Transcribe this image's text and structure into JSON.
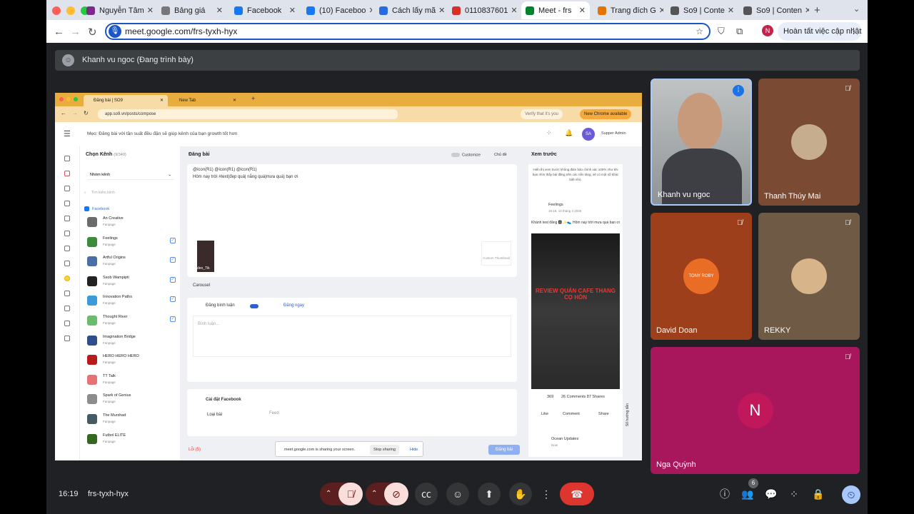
{
  "browser": {
    "tabs": [
      {
        "label": "Nguyễn Tâm",
        "color": "#7b2c8a"
      },
      {
        "label": "Bảng giá",
        "color": "#777777"
      },
      {
        "label": "Facebook",
        "color": "#1877f2"
      },
      {
        "label": "(10) Faceboo",
        "color": "#1877f2"
      },
      {
        "label": "Cách lấy mã",
        "color": "#2a6ae0"
      },
      {
        "label": "0110837601",
        "color": "#d93025"
      },
      {
        "label": "Meet - frs",
        "color": "#00832d"
      },
      {
        "label": "Trang đích G",
        "color": "#e37400"
      },
      {
        "label": "So9 | Conte",
        "color": "#555555"
      },
      {
        "label": "So9 | Conten",
        "color": "#555555"
      }
    ],
    "url": "meet.google.com/frs-tyxh-hyx",
    "avatar_letter": "N",
    "update_button": "Hoàn tất việc cập nhật"
  },
  "meet": {
    "presenting_banner": "Khanh vu ngoc (Đang trình bày)",
    "meeting_time": "16:19",
    "meeting_code": "frs-tyxh-hyx",
    "participant_count": "6",
    "participants": [
      {
        "name": "Khanh vu ngoc",
        "state": "speaking"
      },
      {
        "name": "Thanh Thúy Mai",
        "state": "muted"
      },
      {
        "name": "David Doan",
        "state": "muted",
        "logo_text": "TONY ROBY"
      },
      {
        "name": "REKKY",
        "state": "muted"
      },
      {
        "name": "Nga Quỳnh",
        "state": "muted",
        "avatar_letter": "N"
      }
    ]
  },
  "shared_screen": {
    "tabs": [
      "Đăng bài | SO9",
      "New Tab"
    ],
    "url": "app.so9.vn/posts/compose",
    "verify_label": "Verify that it's you",
    "new_chrome_label": "New Chrome available",
    "tip": "Mẹo: Đăng bài với tần suất đều đặn sẽ giúp kênh của bạn growth tốt hơn",
    "user_initials": "SA",
    "user_role": "Supper Admin",
    "channel_header": "Chọn Kênh",
    "channel_count": "(9/340)",
    "channel_group": "Nhóm kênh",
    "channel_search": "Tìm kiếm kênh",
    "facebook_label": "Facebook",
    "channels": [
      {
        "name": "An Creative",
        "type": "Fanpage",
        "checked": false,
        "color": "#6b6b6b"
      },
      {
        "name": "Feelings",
        "type": "Fanpage",
        "checked": true,
        "color": "#3c8c3c"
      },
      {
        "name": "Artful Origins",
        "type": "Fanpage",
        "checked": true,
        "color": "#4a6fa5"
      },
      {
        "name": "Ssob Wampipti",
        "type": "Fanpage",
        "checked": true,
        "color": "#222222"
      },
      {
        "name": "Innovation Paths",
        "type": "Fanpage",
        "checked": true,
        "color": "#3a9bd8"
      },
      {
        "name": "Thought River",
        "type": "Fanpage",
        "checked": true,
        "color": "#6dbb6d"
      },
      {
        "name": "Imagination Bridge",
        "type": "Fanpage",
        "checked": false,
        "color": "#2e4e8c"
      },
      {
        "name": "HERO HERO HERO",
        "type": "Fanpage",
        "checked": false,
        "color": "#b71c1c"
      },
      {
        "name": "TT Talk",
        "type": "Fanpage",
        "checked": false,
        "color": "#e57373"
      },
      {
        "name": "Spark of Genius",
        "type": "Fanpage",
        "checked": false,
        "color": "#8d8d8d"
      },
      {
        "name": "The Murshad",
        "type": "Fanpage",
        "checked": false,
        "color": "#455a64"
      },
      {
        "name": "Futbol ELITE",
        "type": "Fanpage",
        "checked": false,
        "color": "#33691e"
      }
    ],
    "compose_title": "Đăng bài",
    "customize_label": "Customize",
    "theme_label": "Chủ đề",
    "compose_line1": "@icon(R1) @icon(R1) @icon(R1)",
    "compose_line2": "Hôm nay trời #text(đẹp quá| nắng quá|mưa quá) bạn ơi",
    "video_label": "deo_Tik",
    "custom_thumbnail": "Custom Thumbnail",
    "carousel_label": "Carousel",
    "comment_toggle": "Đăng bình luận",
    "post_now": "Đăng ngay",
    "comment_placeholder": "Bình luận...",
    "fb_settings": "Cài đặt Facebook",
    "post_type_label": "Loại bài",
    "post_type_value": "Feed",
    "error_label": "Lỗi (5)",
    "submit_label": "Đăng bài",
    "preview_title": "Xem trước",
    "preview_note": "Hiển thị xem trước không đảm bảo chính xác 100% như khi bạn nhìn thấy bài đăng trên các nền tảng, sẽ có một số khác biệt nhỏ.",
    "preview_page": "Feelings",
    "preview_date": "16:19, 14 tháng 4 2025",
    "preview_text": "Khánh test đăng 🅰 ✨👟 Hôm nay trời mưa quá bạn ơi",
    "video_overlay": "REVIEW QUÁN CAFE THANG CỌ HỒN",
    "reactions_count": "369",
    "comments_shares": "26 Comments 87 Shares",
    "like_label": "Like",
    "comment_label": "Comment",
    "share_label": "Share",
    "next_page": "Ocean Updates",
    "next_time": "Now",
    "guide_label": "Sổ hướng dẫn",
    "share_notice": "meet.google.com is sharing your screen.",
    "stop_sharing": "Stop sharing",
    "hide": "Hide"
  }
}
